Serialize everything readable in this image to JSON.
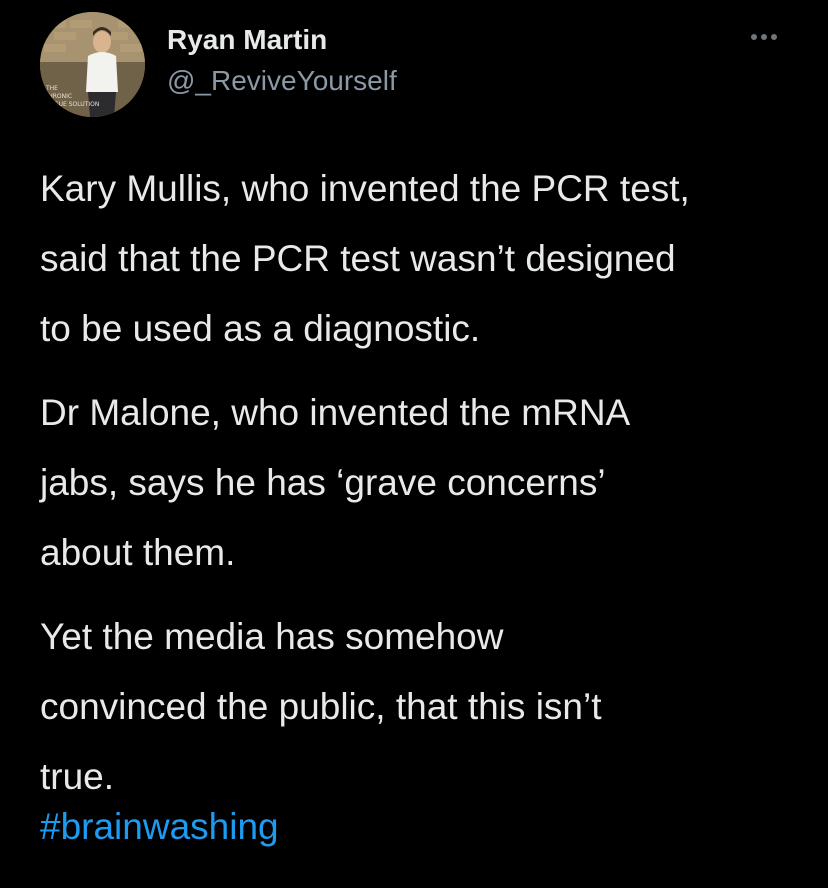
{
  "author": {
    "display_name": "Ryan Martin",
    "handle": "@_ReviveYourself",
    "avatar_icon": "profile-photo"
  },
  "more_icon": "more-horizontal-icon",
  "tweet": {
    "paragraphs": [
      {
        "lines": [
          "Kary Mullis, who invented the PCR test,",
          "said that the PCR test wasn’t designed",
          "to be used as a diagnostic."
        ]
      },
      {
        "lines": [
          "Dr Malone, who invented the mRNA",
          "jabs, says he has ‘grave concerns’",
          "about them."
        ]
      },
      {
        "lines": [
          "Yet the media has somehow",
          "convinced the public, that this isn’t",
          "true."
        ]
      }
    ],
    "hashtag": "#brainwashing"
  },
  "colors": {
    "background": "#000000",
    "text": "#e7e9ea",
    "secondary_text": "#8b98a5",
    "link": "#1d9bf0"
  }
}
